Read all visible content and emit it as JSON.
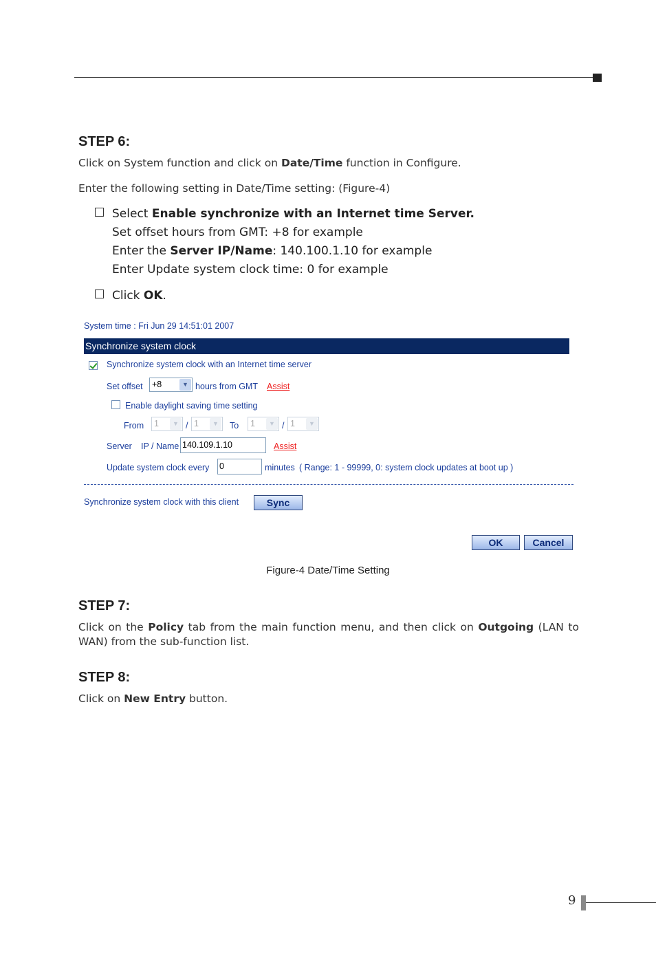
{
  "step6": {
    "title": "STEP 6:",
    "line1_a": "Click on System function and click on ",
    "line1_b": "Date/Time",
    "line1_c": " function in Configure.",
    "line2": "Enter the following setting in Date/Time setting: (Figure-4)",
    "bullet1_a": "Select ",
    "bullet1_b": "Enable synchronize with an Internet time Server.",
    "sub1": "Set offset hours from GMT: +8 for example",
    "sub2_a": "Enter the ",
    "sub2_b": "Server IP/Name",
    "sub2_c": ": 140.100.1.10 for example",
    "sub3": "Enter Update system clock time: 0 for example",
    "bullet2_a": "Click ",
    "bullet2_b": "OK",
    "bullet2_c": "."
  },
  "figure": {
    "system_time": "System time : Fri Jun 29 14:51:01 2007",
    "section_title": "Synchronize system clock",
    "sync_checkbox_label": "Synchronize system clock with an Internet time server",
    "sync_checked": true,
    "set_offset_label": "Set offset",
    "offset_value": "+8",
    "hours_label": "hours from GMT",
    "assist": "Assist",
    "dst_label": "Enable daylight saving time setting",
    "dst_checked": false,
    "from_label": "From",
    "to_label": "To",
    "slash": "/",
    "date_value": "1",
    "server_label": "Server",
    "ipname_label": "IP / Name",
    "server_value": "140.109.1.10",
    "update_label": "Update system clock every",
    "update_value": "0",
    "minutes_label": "minutes",
    "range_label": "( Range: 1 - 99999, 0: system clock updates at boot up )",
    "client_sync_label": "Synchronize system clock with this client",
    "sync_button": "Sync",
    "ok_button": "OK",
    "cancel_button": "Cancel",
    "caption": "Figure-4 Date/Time Setting"
  },
  "step7": {
    "title": "STEP 7:",
    "text_a": "Click on the ",
    "text_b": "Policy",
    "text_c": " tab from the main function menu, and then click on ",
    "text_d": "Outgoing",
    "text_e": " (LAN to WAN) from the sub-function list."
  },
  "step8": {
    "title": "STEP 8:",
    "text_a": "Click on ",
    "text_b": "New Entry",
    "text_c": " button."
  },
  "page_number": "9",
  "colors": {
    "header_bar": "#0a2861",
    "ui_text": "#1a3d9c",
    "assist": "#e22222"
  }
}
